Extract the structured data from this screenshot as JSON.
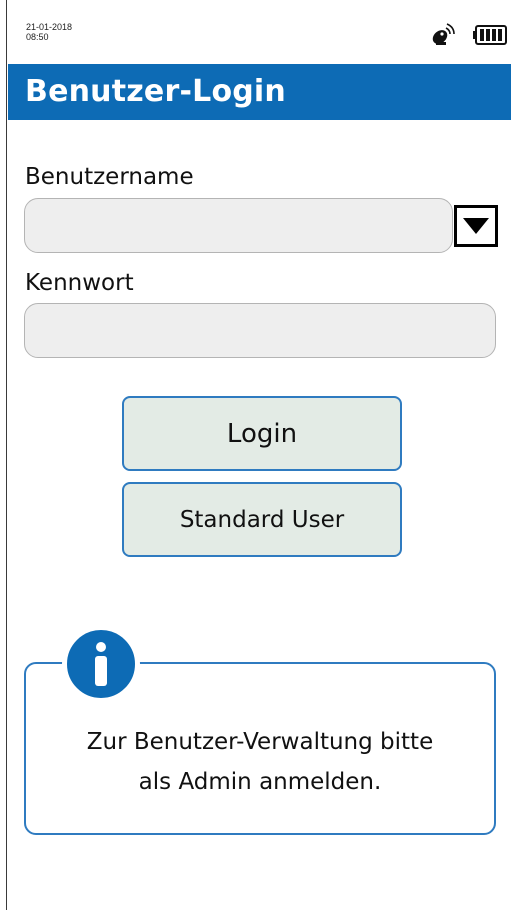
{
  "status": {
    "date": "21-01-2018",
    "time": "08:50",
    "signal_icon": "satellite-dish-icon",
    "battery_icon": "battery-full-icon"
  },
  "header": {
    "title": "Benutzer-Login",
    "color": "#0d6bb5"
  },
  "form": {
    "username_label": "Benutzername",
    "username_value": "",
    "username_dropdown_icon": "triangle-down-icon",
    "password_label": "Kennwort",
    "password_value": ""
  },
  "buttons": {
    "login_label": "Login",
    "standard_user_label": "Standard User"
  },
  "info": {
    "icon": "info-icon",
    "line1": "Zur Benutzer-Verwaltung bitte",
    "line2": "als Admin anmelden."
  },
  "colors": {
    "accent": "#0d6bb5",
    "button_border": "#2f7bc0",
    "button_fill": "#e3ebe5",
    "input_fill": "#eeeeee"
  }
}
